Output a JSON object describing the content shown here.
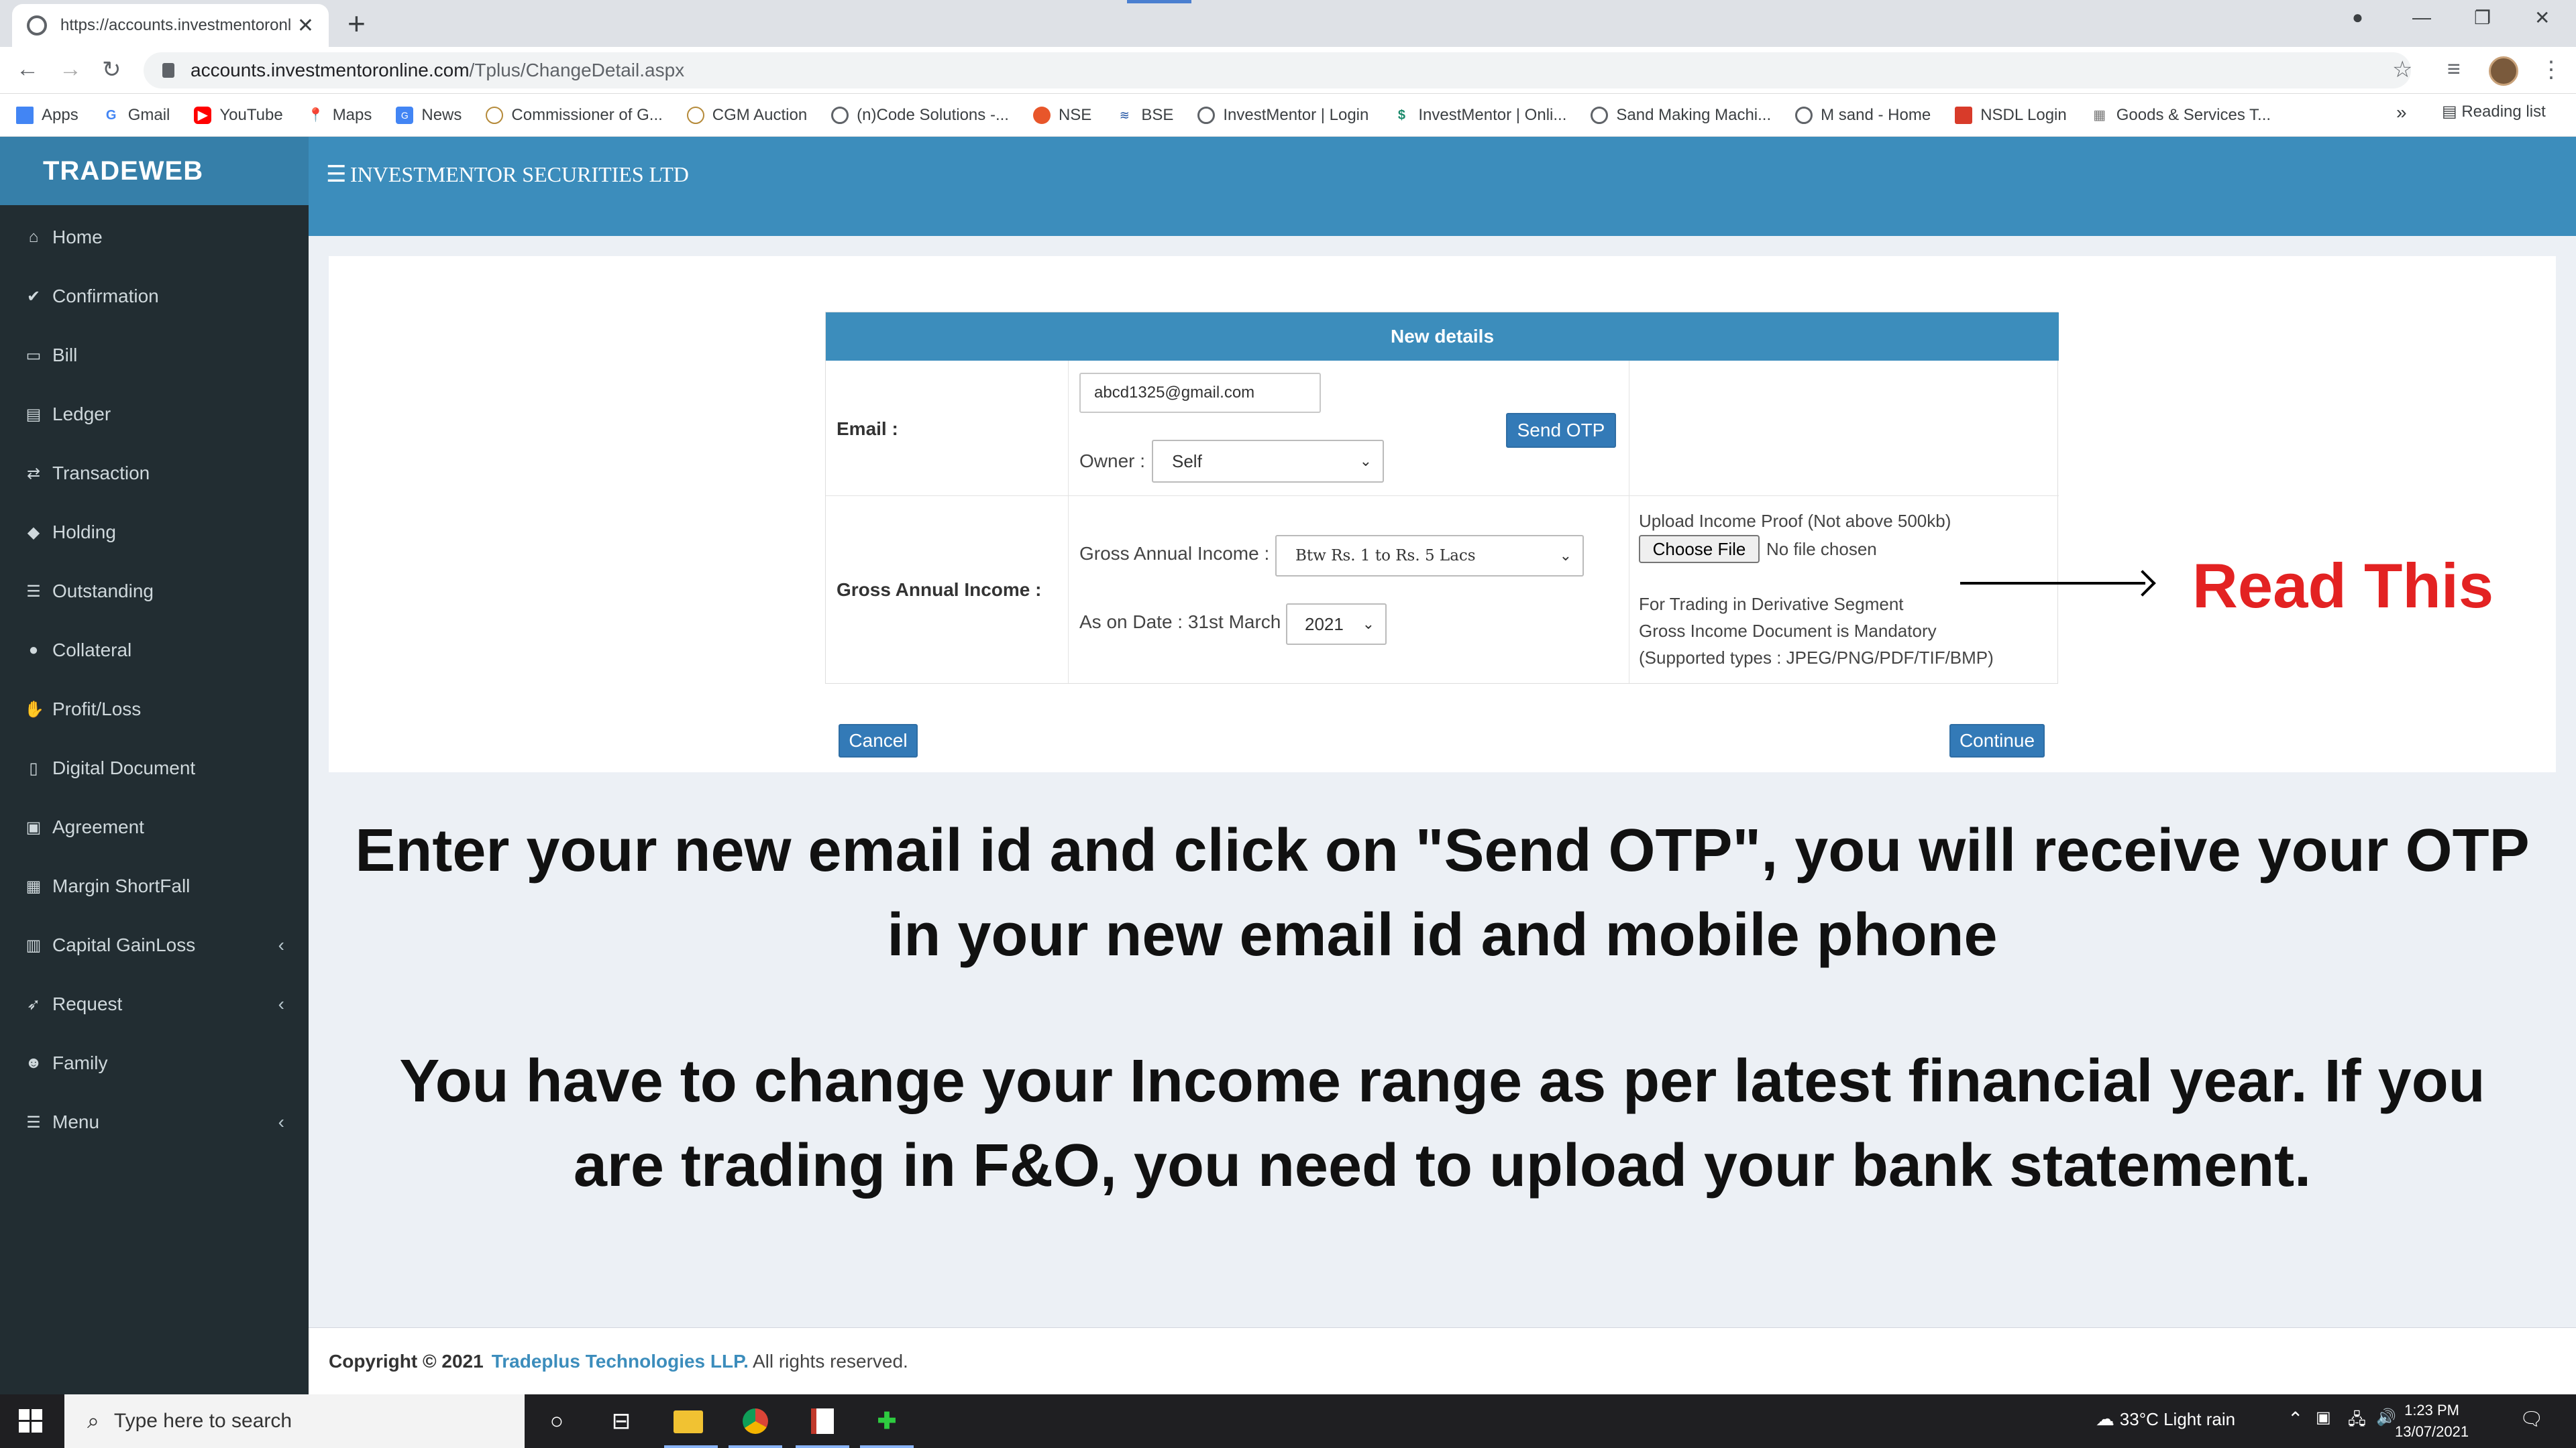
{
  "browser": {
    "tab_title": "https://accounts.investmentoronl",
    "url_host": "accounts.investmentoronline.com",
    "url_path": "/Tplus/ChangeDetail.aspx",
    "bookmarks": [
      "Apps",
      "Gmail",
      "YouTube",
      "Maps",
      "News",
      "Commissioner of G...",
      "CGM Auction",
      "(n)Code Solutions -...",
      "NSE",
      "BSE",
      "InvestMentor | Login",
      "InvestMentor | Onli...",
      "Sand Making Machi...",
      "M sand - Home",
      "NSDL Login",
      "Goods & Services T..."
    ],
    "bookmark_overflow": "»",
    "reading_list": "Reading list"
  },
  "app": {
    "brand": "TRADEWEB",
    "company": "INVESTMENTOR SECURITIES LTD",
    "menu": [
      {
        "label": "Home",
        "icon": "home-icon",
        "glyph": "⌂"
      },
      {
        "label": "Confirmation",
        "icon": "check-circle-icon",
        "glyph": "✔"
      },
      {
        "label": "Bill",
        "icon": "file-icon",
        "glyph": "▭"
      },
      {
        "label": "Ledger",
        "icon": "book-icon",
        "glyph": "▤"
      },
      {
        "label": "Transaction",
        "icon": "exchange-icon",
        "glyph": "⇄"
      },
      {
        "label": "Holding",
        "icon": "tag-icon",
        "glyph": "◆"
      },
      {
        "label": "Outstanding",
        "icon": "list-icon",
        "glyph": "☰"
      },
      {
        "label": "Collateral",
        "icon": "comment-icon",
        "glyph": "●"
      },
      {
        "label": "Profit/Loss",
        "icon": "thumbs-up-icon",
        "glyph": "✋"
      },
      {
        "label": "Digital Document",
        "icon": "pdf-icon",
        "glyph": "▯"
      },
      {
        "label": "Agreement",
        "icon": "id-card-icon",
        "glyph": "▣"
      },
      {
        "label": "Margin ShortFall",
        "icon": "book-icon",
        "glyph": "▦"
      },
      {
        "label": "Capital GainLoss",
        "icon": "bar-chart-icon",
        "glyph": "▥",
        "chevron": "‹"
      },
      {
        "label": "Request",
        "icon": "rocket-icon",
        "glyph": "➶",
        "chevron": "‹"
      },
      {
        "label": "Family",
        "icon": "users-icon",
        "glyph": "☻"
      },
      {
        "label": "Menu",
        "icon": "list-icon",
        "glyph": "☰",
        "chevron": "‹"
      }
    ]
  },
  "form": {
    "header": "New details",
    "email_label": "Email :",
    "email_value": "abcd1325@gmail.com",
    "send_otp": "Send OTP",
    "owner_label": "Owner :",
    "owner_value": "Self",
    "income_row_label": "Gross Annual Income :",
    "income_label": "Gross Annual Income :",
    "income_value": "Btw Rs. 1 to Rs. 5 Lacs",
    "date_label": "As on Date : 31st March",
    "year_value": "2021",
    "upload_label": "Upload Income Proof (Not above 500kb)",
    "choose_file": "Choose File",
    "no_file": "No file chosen",
    "note1": "For Trading in Derivative Segment",
    "note2": "Gross Income Document is Mandatory",
    "note3": "(Supported types : JPEG/PNG/PDF/TIF/BMP)",
    "cancel": "Cancel",
    "continue": "Continue"
  },
  "annotation": {
    "read_this": "Read This",
    "line1": "Enter your new email id and click on \"Send OTP\", you will receive your OTP",
    "line2": "in your new email id and mobile phone",
    "line3": "You have to change your Income range as per latest financial year. If you",
    "line4": "are trading in F&O, you need to upload your bank statement."
  },
  "footer": {
    "copyright": "Copyright © 2021",
    "company": "Tradeplus Technologies LLP.",
    "rights": "All rights reserved."
  },
  "taskbar": {
    "search_placeholder": "Type here to search",
    "weather": "33°C  Light rain",
    "time": "1:23 PM",
    "date": "13/07/2021"
  },
  "colors": {
    "primary": "#3c8dbc",
    "sidebar": "#222d32",
    "accent_red": "#e32222"
  }
}
